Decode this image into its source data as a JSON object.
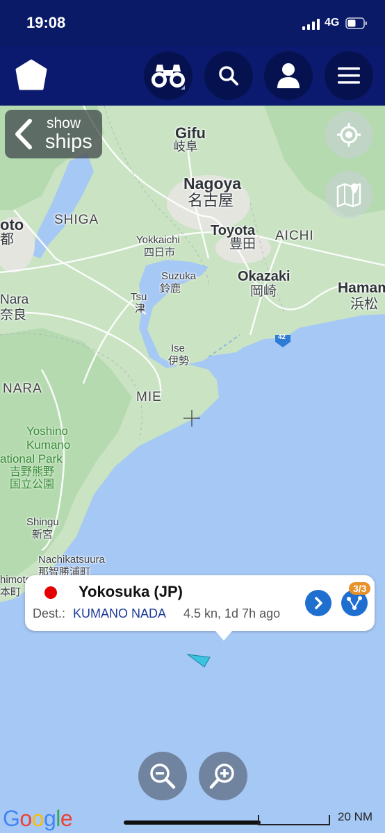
{
  "status_bar": {
    "time": "19:08",
    "network": "4G"
  },
  "nav": {
    "buttons": [
      "home-icon",
      "binoculars-icon",
      "search-icon",
      "user-icon",
      "menu-icon"
    ]
  },
  "map": {
    "show_ships": {
      "line1": "show",
      "line2": "ships"
    },
    "labels": {
      "gifu_en": "Gifu",
      "gifu_ja": "岐阜",
      "nagoya_en": "Nagoya",
      "nagoya_ja": "名古屋",
      "toyota_en": "Toyota",
      "toyota_ja": "豊田",
      "aichi": "AICHI",
      "shiga": "SHIGA",
      "kyoto_en": "oto",
      "kyoto_ja": "都",
      "yokkaichi_en": "Yokkaichi",
      "yokkaichi_ja": "四日市",
      "suzuka_en": "Suzuka",
      "suzuka_ja": "鈴鹿",
      "okazaki_en": "Okazaki",
      "okazaki_ja": "岡崎",
      "hamamatsu_en": "Hamam",
      "hamamatsu_ja": "浜松",
      "tsu_en": "Tsu",
      "tsu_ja": "津",
      "nara_en": "Nara",
      "nara_ja": "奈良",
      "ise_en": "Ise",
      "ise_ja": "伊勢",
      "nara_pref": "NARA",
      "mie": "MIE",
      "park_l1": "Yoshino",
      "park_l2": "Kumano",
      "park_l3": "ational Park",
      "park_l4": "吉野熊野",
      "park_l5": "国立公園",
      "shingu_en": "Shingu",
      "shingu_ja": "新宮",
      "nachi_en": "Nachikatsuura",
      "nachi_ja": "那智勝浦町",
      "himoto_en": "himoto",
      "himoto_ja": "本町",
      "route42": "42"
    },
    "popup": {
      "vessel_name": "Yokosuka (JP)",
      "dest_label": "Dest.:",
      "destination": "KUMANO NADA",
      "speed_age": "4.5 kn, 1d 7h ago",
      "route_badge": "3/3"
    },
    "google": "Google",
    "scale": "20 NM"
  }
}
